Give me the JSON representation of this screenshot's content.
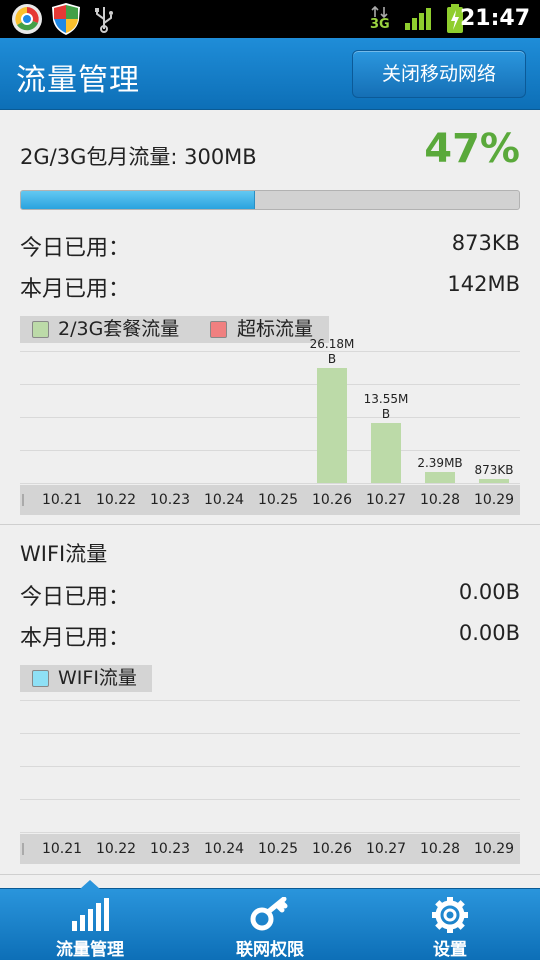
{
  "status_bar": {
    "time": "21:47",
    "network": "3G",
    "icons": [
      "browser-icon",
      "shield-icon",
      "usb-icon",
      "data-3g-icon",
      "signal-icon",
      "battery-charging-icon"
    ]
  },
  "header": {
    "title": "流量管理",
    "close_network_button": "关闭移动网络"
  },
  "mobile": {
    "title": "2G/3G包月流量: 300MB",
    "percent_text": "47%",
    "percent_value": 47,
    "today_label": "今日已用：",
    "today_value": "873KB",
    "month_label": "本月已用：",
    "month_value": "142MB",
    "legend": [
      {
        "label": "2/3G套餐流量",
        "color": "#bcdaa8"
      },
      {
        "label": "超标流量",
        "color": "#f08080"
      }
    ]
  },
  "wifi": {
    "title": "WIFI流量",
    "today_label": "今日已用：",
    "today_value": "0.00B",
    "month_label": "本月已用：",
    "month_value": "0.00B",
    "legend": [
      {
        "label": "WIFI流量",
        "color": "#8ee0f5"
      }
    ]
  },
  "chart_data": [
    {
      "type": "bar",
      "categories": [
        "10.21",
        "10.22",
        "10.23",
        "10.24",
        "10.25",
        "10.26",
        "10.27",
        "10.28",
        "10.29"
      ],
      "values_mb": [
        0,
        0,
        0,
        0,
        0,
        26.18,
        13.55,
        2.39,
        0.853
      ],
      "data_labels": [
        "",
        "",
        "",
        "",
        "",
        "26.18M\nB",
        "13.55M\nB",
        "2.39MB",
        "873KB"
      ],
      "ylim": [
        0,
        30
      ],
      "grid": true
    },
    {
      "type": "bar",
      "categories": [
        "10.21",
        "10.22",
        "10.23",
        "10.24",
        "10.25",
        "10.26",
        "10.27",
        "10.28",
        "10.29"
      ],
      "values_mb": [
        0,
        0,
        0,
        0,
        0,
        0,
        0,
        0,
        0
      ],
      "ylim": [
        0,
        30
      ],
      "grid": true
    }
  ],
  "bottom_nav": [
    {
      "label": "流量管理",
      "icon": "bar-chart-icon",
      "active": true
    },
    {
      "label": "联网权限",
      "icon": "key-icon",
      "active": false
    },
    {
      "label": "设置",
      "icon": "gear-icon",
      "active": false
    }
  ],
  "colors": {
    "accent_blue": "#1a82cc",
    "percent_green": "#5aa93b",
    "bar_green": "#bcdaa8",
    "progress_blue": "#2aa3de"
  }
}
